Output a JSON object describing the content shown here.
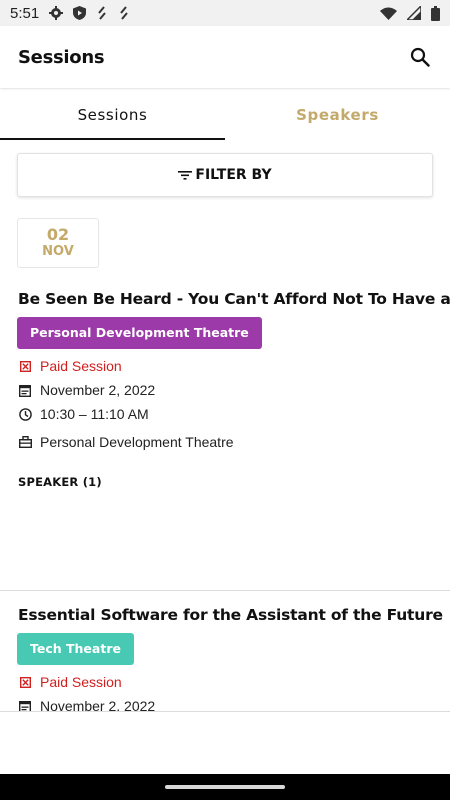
{
  "status_bar": {
    "time": "5:51",
    "left_icons": [
      "gear-icon",
      "shield-play-icon",
      "link-icon",
      "link-icon"
    ],
    "right_icons": [
      "wifi-icon",
      "signal-icon",
      "battery-icon"
    ]
  },
  "app_bar": {
    "title": "Sessions",
    "search_icon": "search-icon"
  },
  "tabs": [
    {
      "label": "Sessions",
      "active": true
    },
    {
      "label": "Speakers",
      "active": false
    }
  ],
  "filter": {
    "label": "FILTER BY",
    "icon": "filter-icon"
  },
  "date_chip": {
    "day": "02",
    "month": "NOV"
  },
  "colors": {
    "accent_gold": "#c3a96a",
    "paid_red": "#d02020",
    "personal_dev_track": "#9b3aa8",
    "tech_track": "#48c9b4"
  },
  "sessions": [
    {
      "title": "Be Seen Be Heard - You Can't Afford Not To Have a Voice",
      "track": "Personal Development Theatre",
      "paid_label": "Paid Session",
      "date": "November 2, 2022",
      "time": "10:30 – 11:10 AM",
      "room": "Personal Development Theatre",
      "speaker_header": "SPEAKER (1)"
    },
    {
      "title": "Essential Software for the Assistant of the Future",
      "track": "Tech Theatre",
      "paid_label": "Paid Session",
      "date": "November 2, 2022"
    }
  ]
}
